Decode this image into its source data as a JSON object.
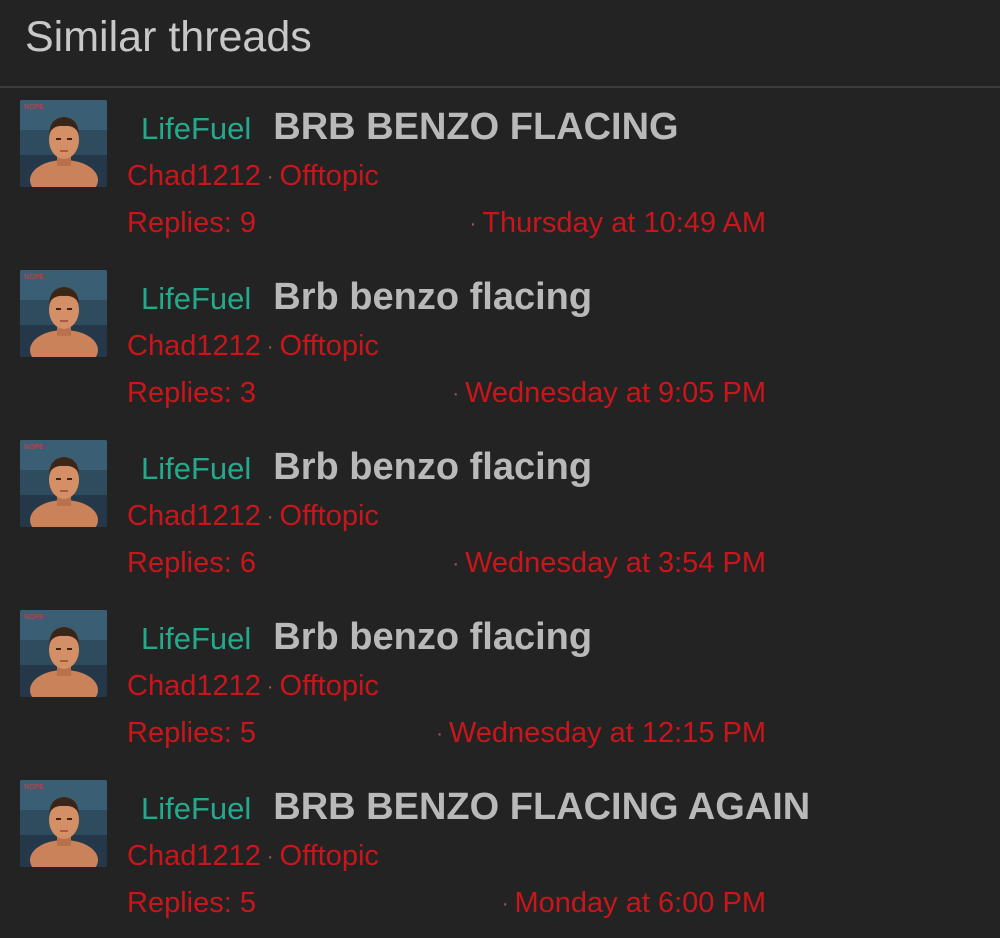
{
  "block": {
    "title": "Similar threads"
  },
  "threads": [
    {
      "prefix": "LifeFuel",
      "title": "BRB BENZO FLACING",
      "author": "Chad1212",
      "forum": "Offtopic",
      "replies": "Replies: 9",
      "last_post": "Thursday at 10:49 AM"
    },
    {
      "prefix": "LifeFuel",
      "title": "Brb benzo flacing",
      "author": "Chad1212",
      "forum": "Offtopic",
      "replies": "Replies: 3",
      "last_post": "Wednesday at 9:05 PM"
    },
    {
      "prefix": "LifeFuel",
      "title": "Brb benzo flacing",
      "author": "Chad1212",
      "forum": "Offtopic",
      "replies": "Replies: 6",
      "last_post": "Wednesday at 3:54 PM"
    },
    {
      "prefix": "LifeFuel",
      "title": "Brb benzo flacing",
      "author": "Chad1212",
      "forum": "Offtopic",
      "replies": "Replies: 5",
      "last_post": "Wednesday at 12:15 PM"
    },
    {
      "prefix": "LifeFuel",
      "title": "BRB BENZO FLACING AGAIN",
      "author": "Chad1212",
      "forum": "Offtopic",
      "replies": "Replies: 5",
      "last_post": "Monday at 6:00 PM"
    }
  ],
  "separator": "·",
  "colors": {
    "background": "#232323",
    "prefix": "#25a98c",
    "title": "#b9b9b9",
    "meta": "#c8161b"
  }
}
